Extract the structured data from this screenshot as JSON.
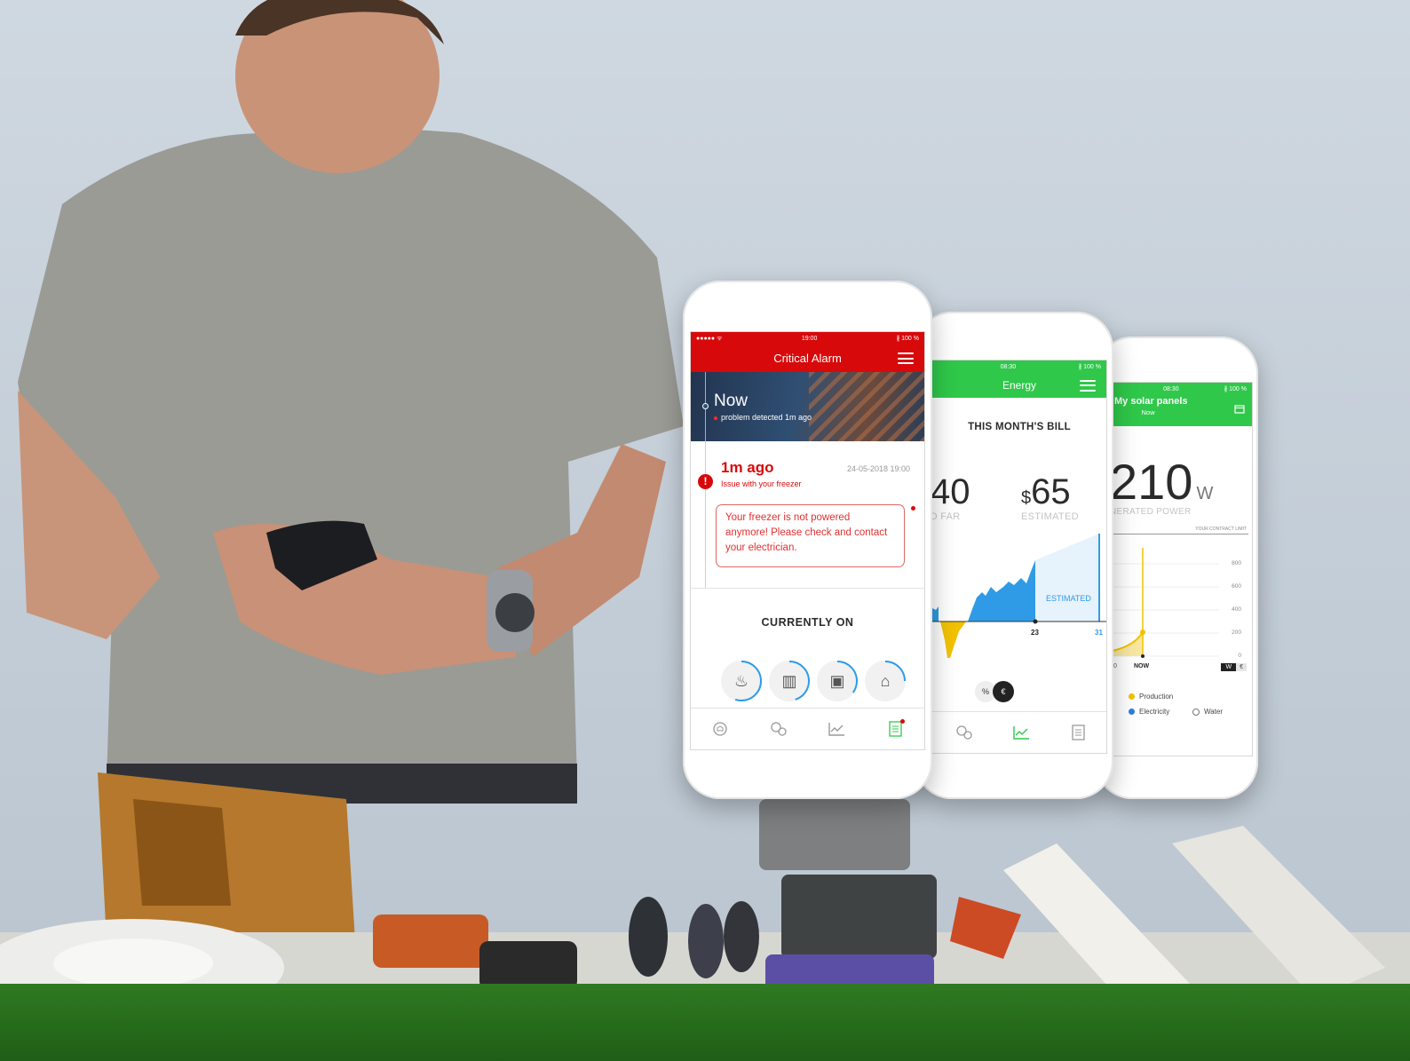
{
  "colors": {
    "alarm_red": "#d8090b",
    "energy_green": "#2fc84a",
    "chart_blue": "#2f9be6",
    "chart_yellow": "#f2c200"
  },
  "phone1": {
    "status": {
      "signal": "●●●●● ᯤ",
      "time": "19:00",
      "battery": "∦ 100 %"
    },
    "title": "Critical Alarm",
    "hero": {
      "title": "Now",
      "subtitle": "problem detected 1m ago"
    },
    "alarm": {
      "time_ago": "1m ago",
      "date": "24-05-2018 19:00",
      "issue": "Issue with your freezer",
      "message": "Your freezer is not powered anymore! Please check and contact your electrician."
    },
    "currently_on_title": "CURRENTLY ON",
    "appliances": [
      {
        "icon": "kettle-icon",
        "progress": 0.55
      },
      {
        "icon": "radiator-icon",
        "progress": 0.45
      },
      {
        "icon": "washer-icon",
        "progress": 0.35
      },
      {
        "icon": "heater-icon",
        "progress": 0.25
      }
    ],
    "tabs": [
      "home-icon",
      "devices-icon",
      "chart-icon",
      "report-icon"
    ]
  },
  "phone2": {
    "status": {
      "time": "08:30",
      "battery": "∦ 100 %"
    },
    "title": "Energy",
    "bill_title": "THIS MONTH'S BILL",
    "so_far_value": "40",
    "so_far_label": "O FAR",
    "estimated_currency": "$",
    "estimated_value": "65",
    "estimated_label": "ESTIMATED",
    "chart_estimated_label": "ESTIMATED",
    "day_marker_now": "23",
    "day_marker_end": "31",
    "toggle": {
      "percent": "%",
      "currency": "€"
    },
    "tabs": [
      "devices-icon",
      "chart-icon",
      "report-icon"
    ]
  },
  "phone3": {
    "status": {
      "time": "08:30",
      "battery": "∦ 100 %"
    },
    "title": "My solar panels",
    "subtitle": "Now",
    "power_value": "210",
    "power_unit": "W",
    "power_label": "NERATED POWER",
    "contract_limit_label": "YOUR CONTRACT LIMIT",
    "y_ticks": [
      "800",
      "600",
      "400",
      "200",
      "0"
    ],
    "x_start_label": "0",
    "x_now_label": "NOW",
    "unit_toggle": {
      "w": "W",
      "euro": "€"
    },
    "legend": [
      "Production",
      "Electricity",
      "Water"
    ]
  }
}
